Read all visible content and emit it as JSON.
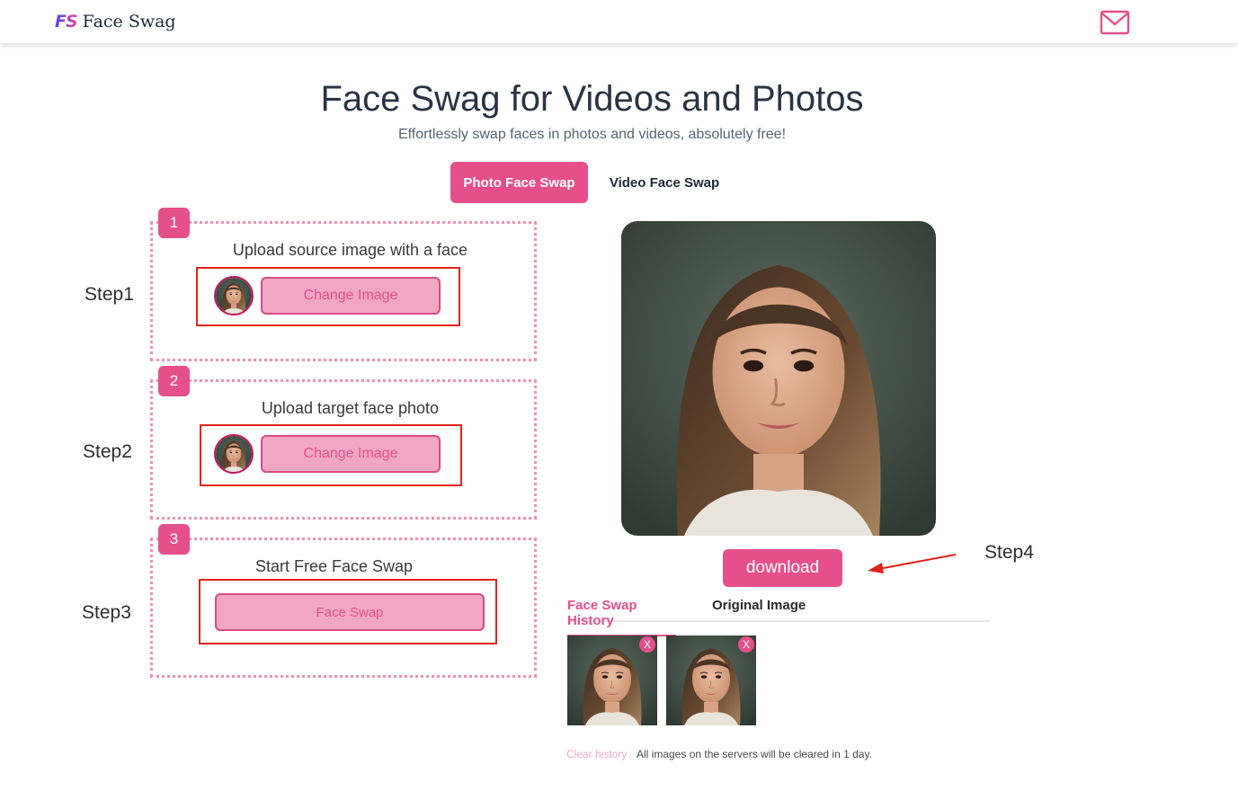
{
  "header": {
    "logo_mark": "FS",
    "logo_text": "Face Swag",
    "mail_icon": "envelope-icon"
  },
  "hero": {
    "title": "Face Swag for Videos and Photos",
    "subtitle": "Effortlessly swap faces in photos and videos, absolutely free!"
  },
  "mode_tabs": {
    "photo": "Photo Face Swap",
    "video": "Video Face Swap",
    "active": "photo"
  },
  "steps": [
    {
      "number": "1",
      "side_label": "Step1",
      "instruction": "Upload source image with a face",
      "button": "Change Image"
    },
    {
      "number": "2",
      "side_label": "Step2",
      "instruction": "Upload target face photo",
      "button": "Change Image"
    },
    {
      "number": "3",
      "side_label": "Step3",
      "instruction": "Start Free Face Swap",
      "button": "Face Swap"
    }
  ],
  "result": {
    "download_label": "download",
    "step_label": "Step4"
  },
  "history": {
    "tabs": [
      "Face Swap History",
      "Original Image"
    ],
    "active_tab": 0,
    "close_label": "X",
    "clear_label": "Clear history",
    "note": "All images on the servers will be cleared in 1 day."
  },
  "colors": {
    "accent": "#e5508a",
    "accent_light": "#f1a7c4",
    "dotted_border": "#f08fb4",
    "annotation_red": "#e3221c"
  }
}
